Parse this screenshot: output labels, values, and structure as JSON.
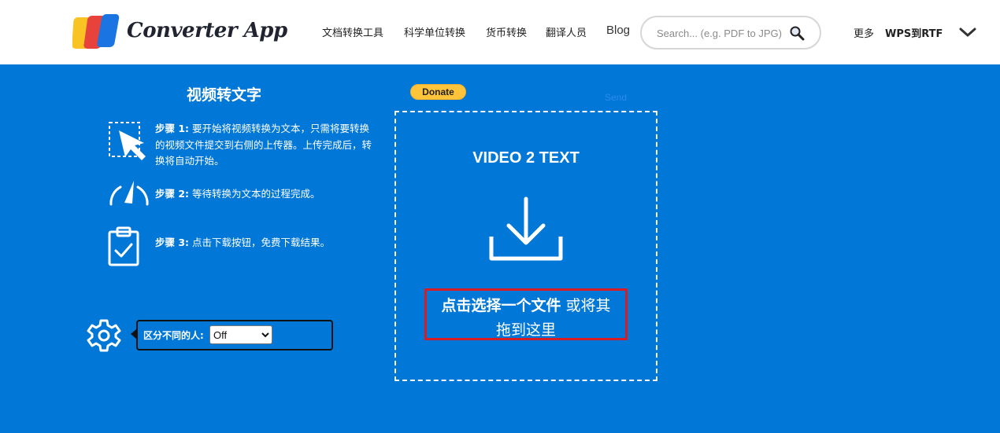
{
  "header": {
    "brand": "Converter App",
    "nav": [
      "文档转换工具",
      "科学单位转换",
      "货币转换",
      "翻译人员",
      "Blog"
    ],
    "search_placeholder": "Search... (e.g. PDF to JPG)",
    "more": "更多",
    "current_tool": "WPS到RTF",
    "logo_colors": [
      "#f9c423",
      "#e8423c",
      "#1a74e2"
    ]
  },
  "tool": {
    "title": "视频转文字",
    "steps": [
      {
        "label": "步骤 1:",
        "text": "要开始将视频转换为文本，只需将要转换的视频文件提交到右侧的上传器。上传完成后，转换将自动开始。",
        "icon": "cursor-select-icon"
      },
      {
        "label": "步骤 2:",
        "text": "等待转换为文本的过程完成。",
        "icon": "gauge-icon"
      },
      {
        "label": "步骤 3:",
        "text": "点击下载按钮，免费下载结果。",
        "icon": "clipboard-check-icon"
      }
    ],
    "option": {
      "label": "区分不同的人:",
      "value": "Off"
    }
  },
  "upload": {
    "donate": "Donate",
    "ghost_text": "Send",
    "title": "VIDEO 2 TEXT",
    "choose_strong": "点击选择一个文件",
    "choose_rest": "或将其",
    "choose_line2": "拖到这里"
  },
  "colors": {
    "background": "#0177d7",
    "highlight_border": "#d71c24",
    "donate": "#ffc439"
  }
}
